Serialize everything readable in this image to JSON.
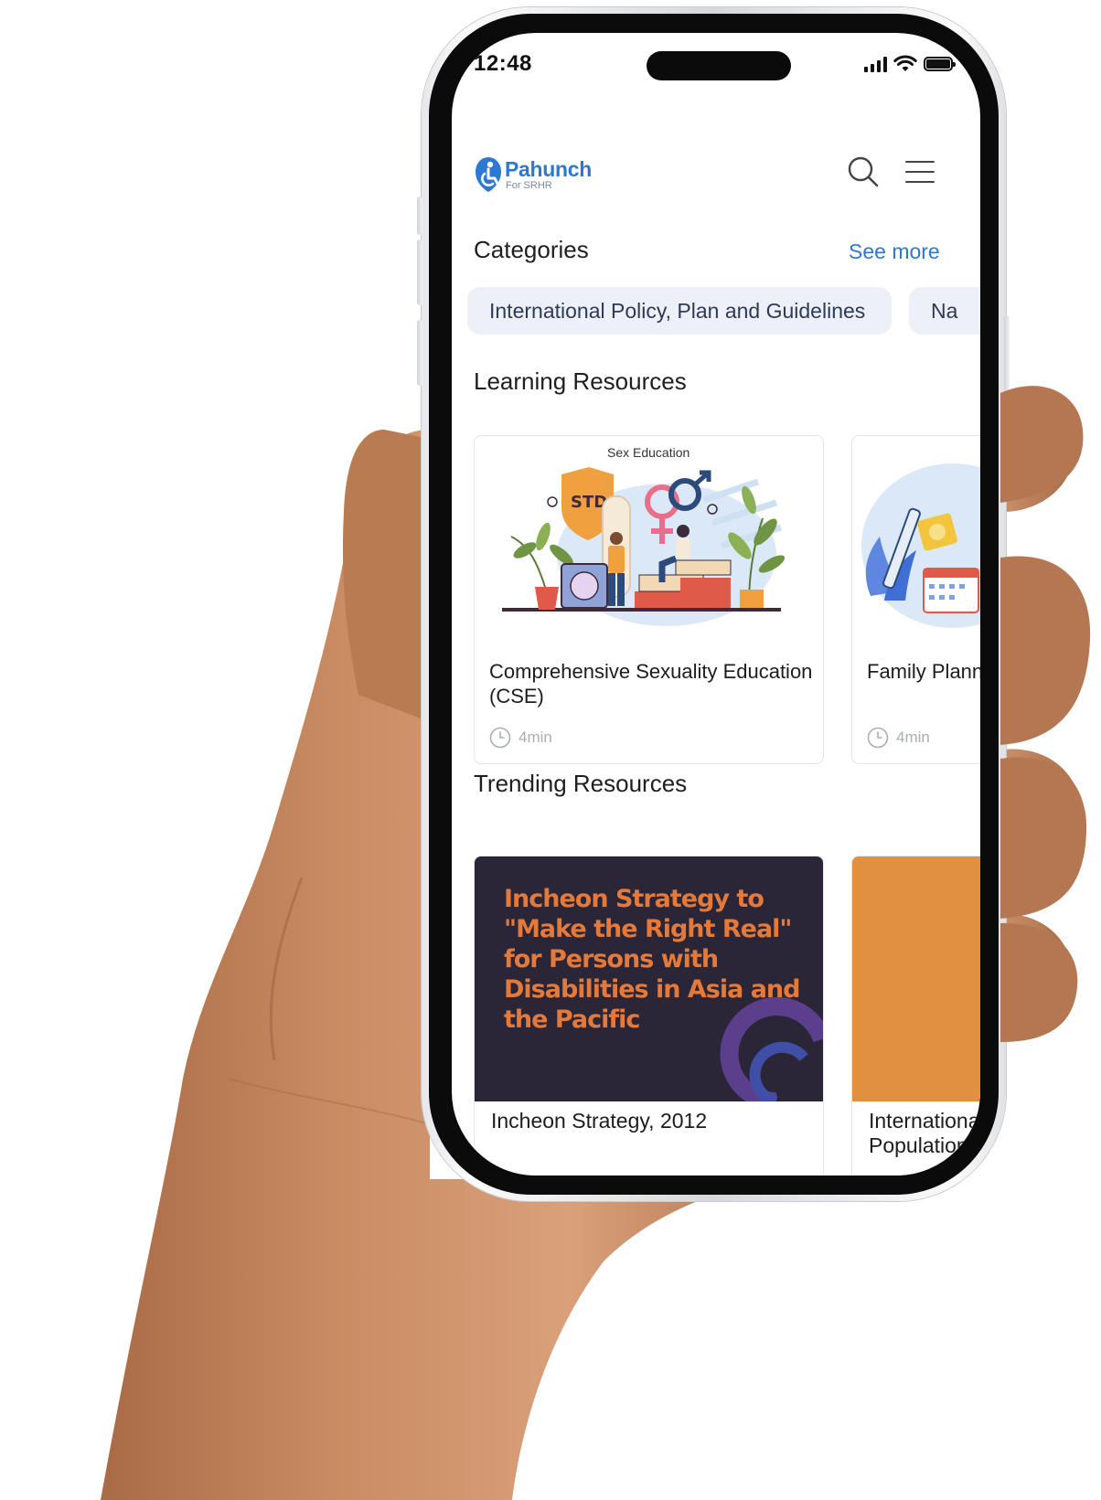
{
  "status_bar": {
    "time": "12:48"
  },
  "header": {
    "logo_name": "Pahunch",
    "logo_sub": "For SRHR"
  },
  "categories": {
    "title": "Categories",
    "see_more": "See more",
    "chips": [
      "International Policy, Plan and Guidelines",
      "Na"
    ]
  },
  "learning": {
    "title": "Learning Resources",
    "cards": [
      {
        "image_caption": "Sex Education",
        "title": "Comprehensive Sexuality Education (CSE)",
        "duration": "4min"
      },
      {
        "title": "Family Planning Contraception",
        "duration": "4min"
      }
    ]
  },
  "trending": {
    "title": "Trending Resources",
    "cards": [
      {
        "poster_text": "Incheon Strategy to \"Make the Right Real\" for Persons with Disabilities in Asia and the Pacific",
        "title": "Incheon Strategy, 2012"
      },
      {
        "title": "International Population"
      }
    ]
  },
  "colors": {
    "brand_blue": "#2d78d2",
    "chip_bg": "#eef0f7",
    "poster_bg": "#2a2638",
    "poster_text": "#e4793a",
    "orange_card": "#e09040"
  }
}
